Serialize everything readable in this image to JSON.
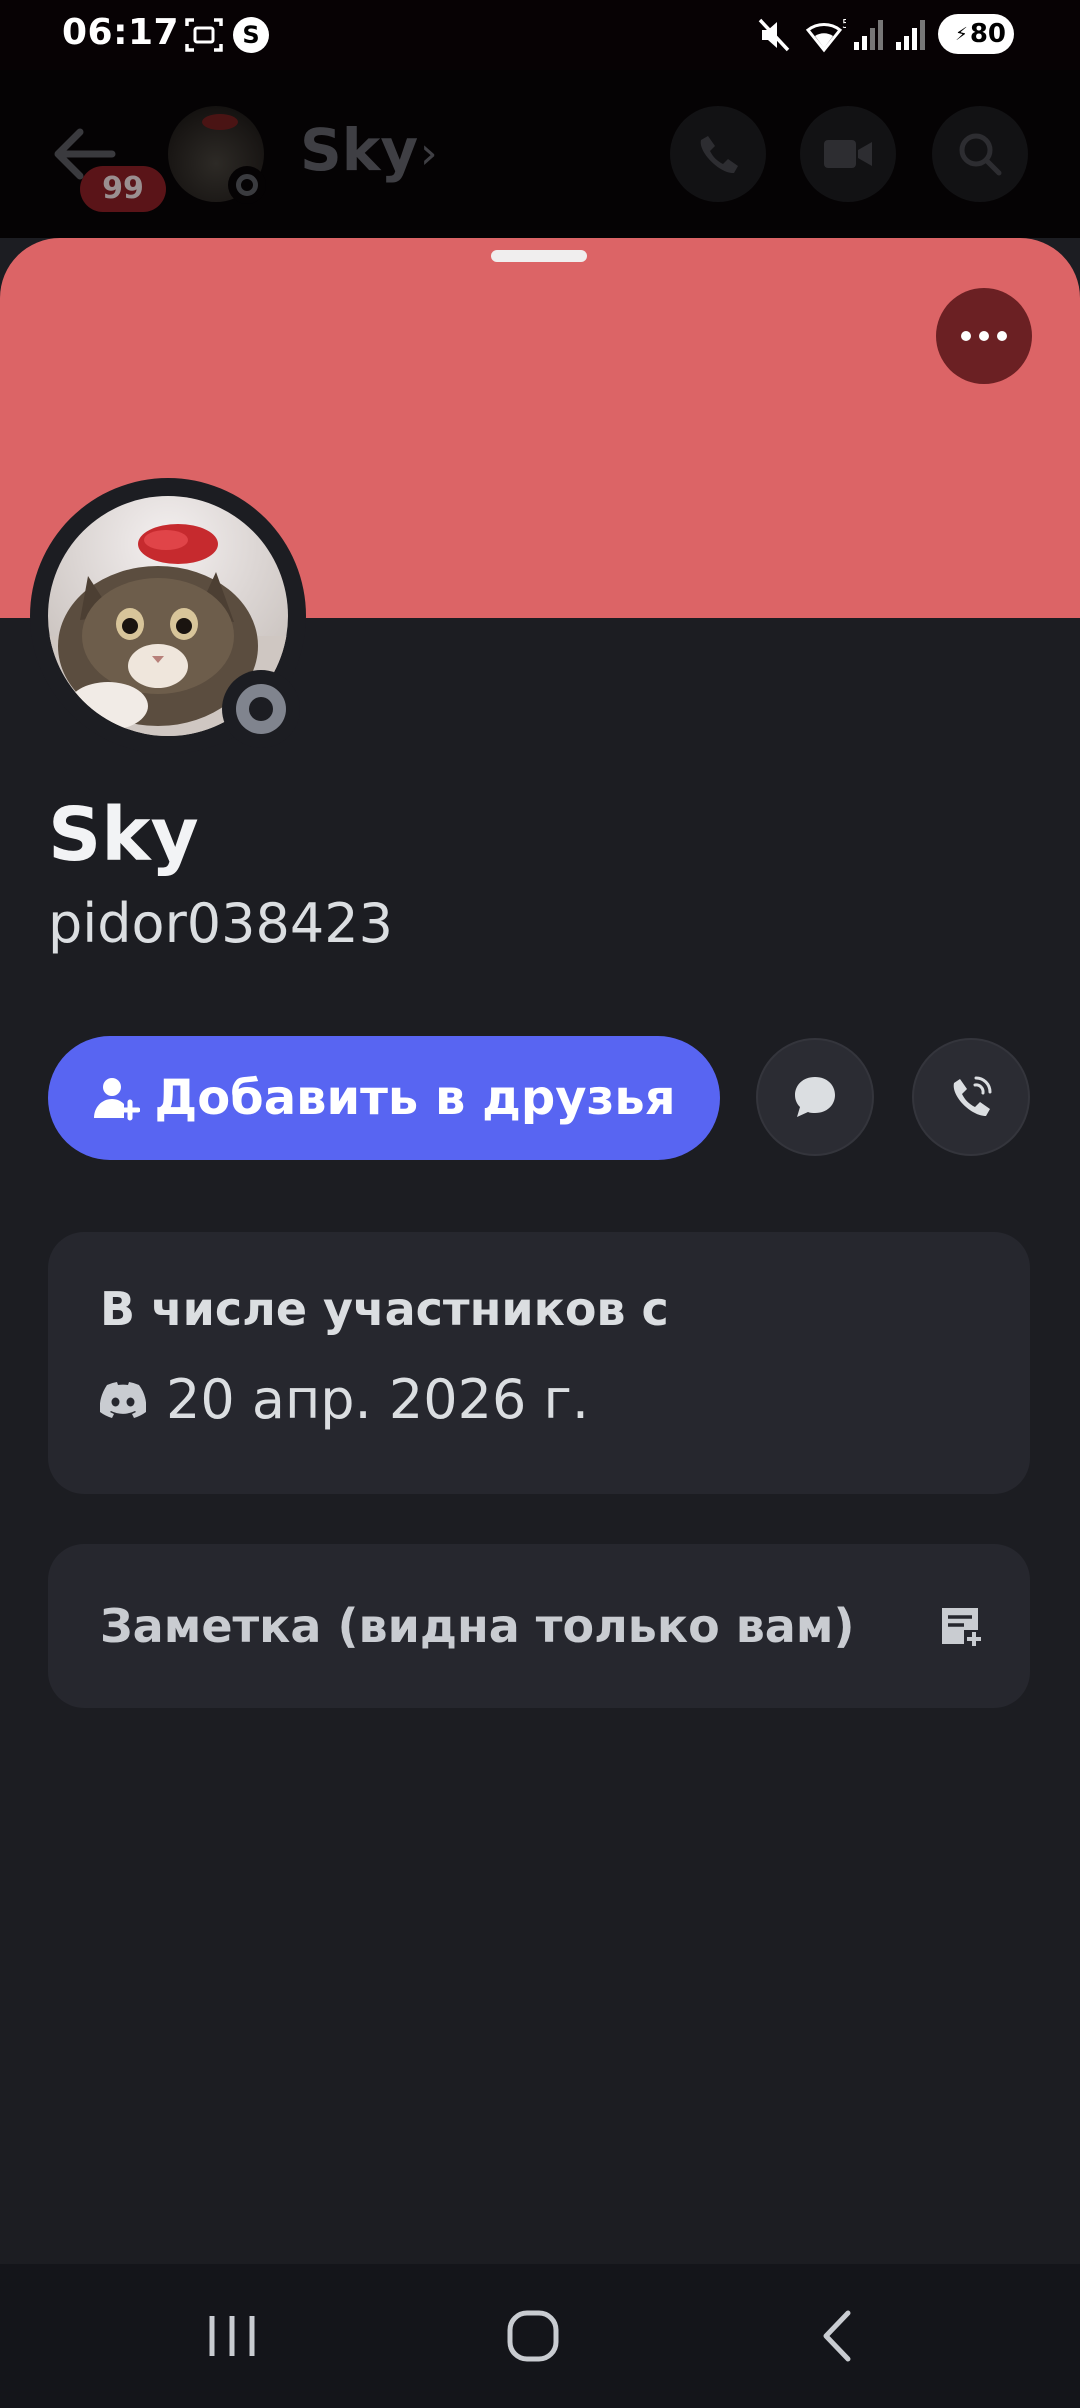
{
  "status_bar": {
    "time": "06:17",
    "battery": "80",
    "network": "5",
    "icons": [
      "screenshot-icon",
      "s-app-icon",
      "mute-icon",
      "wifi-icon",
      "signal-icon",
      "signal-icon",
      "battery-icon"
    ]
  },
  "chat_header": {
    "unread_count": "99",
    "name": "Sky",
    "actions": [
      "voice-call-icon",
      "video-call-icon",
      "search-icon"
    ]
  },
  "profile": {
    "display_name": "Sky",
    "username": "pidor038423",
    "status": "offline",
    "banner_color": "#dc6466",
    "add_friend_label": "Добавить в друзья",
    "member_since_title": "В числе участников с",
    "member_since_date": "20 апр. 2026 г.",
    "note_label": "Заметка (видна только вам)"
  },
  "colors": {
    "accent": "#5865f2",
    "background": "#1c1d22",
    "card": "#26272e"
  }
}
